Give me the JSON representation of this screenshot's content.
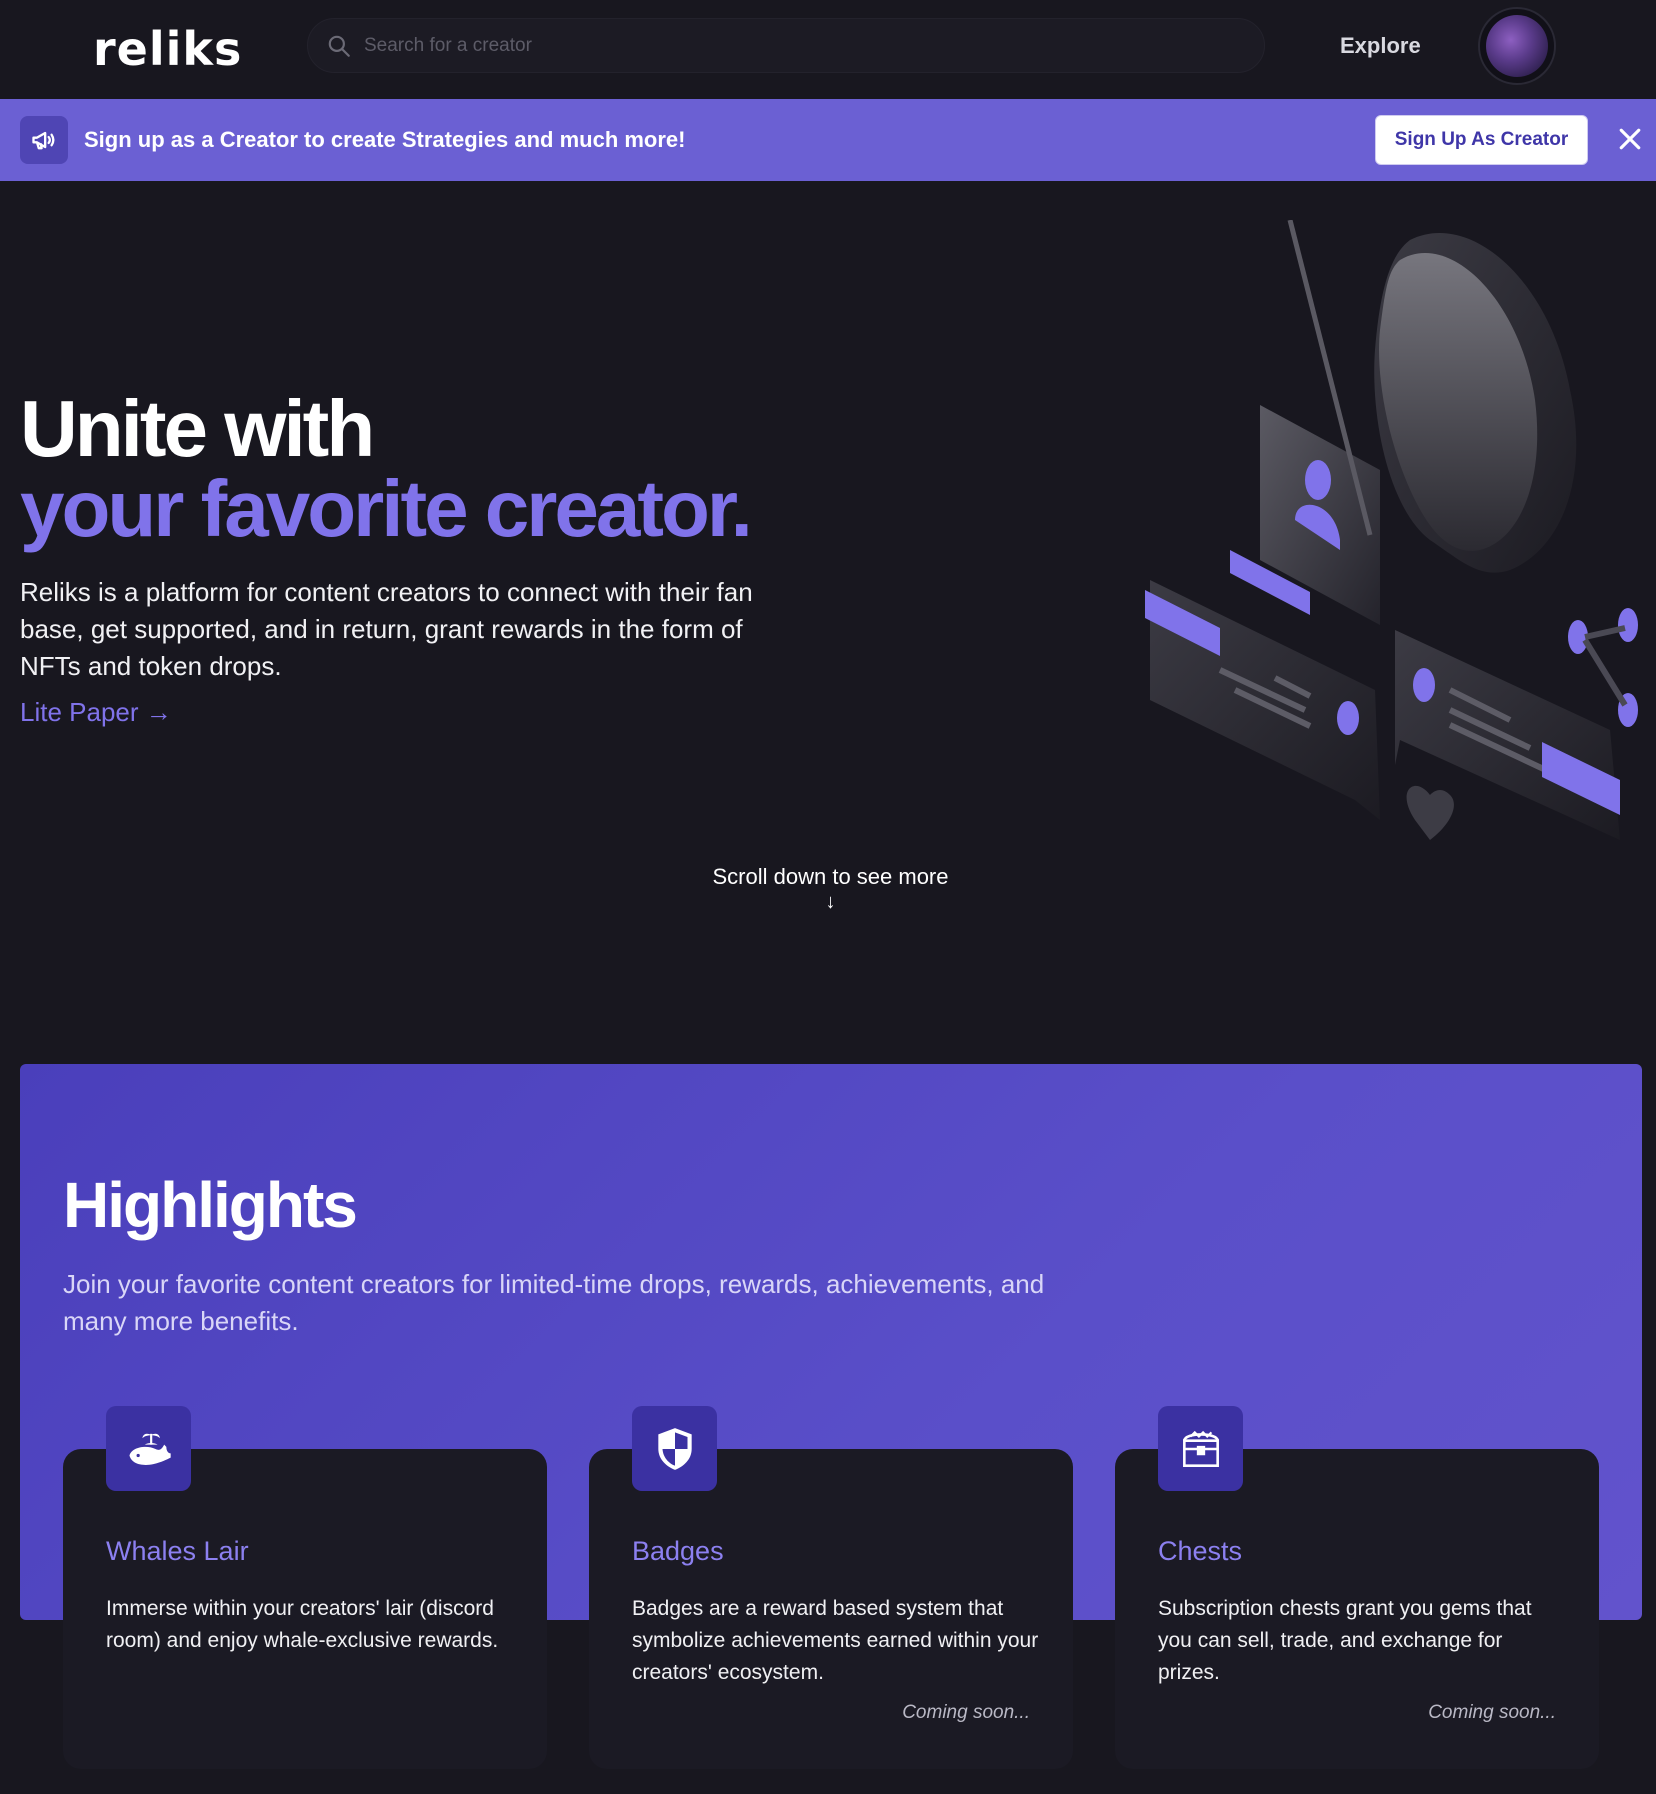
{
  "header": {
    "logo": "reliks",
    "search_placeholder": "Search for a creator",
    "explore_label": "Explore",
    "avatar_icon": "user-avatar"
  },
  "banner": {
    "text": "Sign up as a Creator to create Strategies and much more!",
    "button_label": "Sign Up As Creator",
    "icon": "megaphone-icon",
    "close_icon": "close-icon"
  },
  "hero": {
    "title_line1": "Unite with",
    "title_line2": "your favorite creator.",
    "description": "Reliks is a platform for content creators to connect with their fan base, get supported, and in return, grant rewards in the form of NFTs and token drops.",
    "lite_paper_label": "Lite Paper →",
    "scroll_hint": "Scroll down to see more",
    "scroll_arrow": "↓"
  },
  "highlights": {
    "title": "Highlights",
    "description": "Join your favorite content creators for limited-time drops, rewards, achievements, and many more benefits.",
    "cards": [
      {
        "icon": "whale-icon",
        "title": "Whales Lair",
        "text": "Immerse within your creators' lair (discord room) and enjoy whale-exclusive rewards.",
        "status": ""
      },
      {
        "icon": "shield-icon",
        "title": "Badges",
        "text": "Badges are a reward based system that symbolize achievements earned within your creators' ecosystem.",
        "status": "Coming soon..."
      },
      {
        "icon": "chest-icon",
        "title": "Chests",
        "text": "Subscription chests grant you gems that you can sell, trade, and exchange for prizes.",
        "status": "Coming soon..."
      }
    ]
  },
  "colors": {
    "background": "#18171f",
    "accent": "#8073ea",
    "banner": "#6b60d3",
    "highlights_panel": "#5247c2",
    "card": "#1b1a24"
  }
}
